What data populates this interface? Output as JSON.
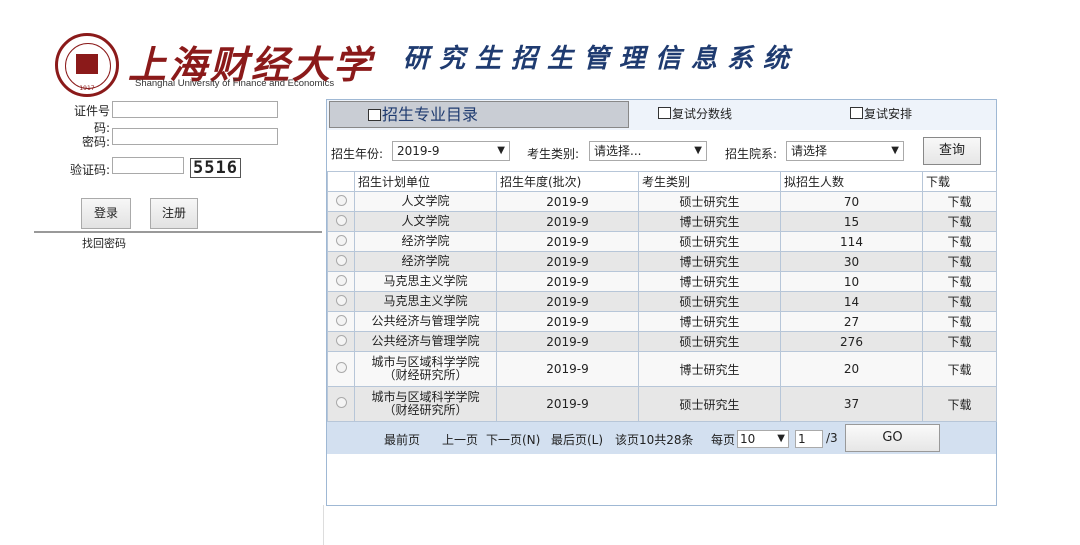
{
  "header": {
    "seal_year": "1917",
    "university_cn": "上海财经大学",
    "university_en": "Shanghai University of Finance and Economics",
    "system_title": "研究生招生管理信息系统"
  },
  "login": {
    "id_label": "证件号码:",
    "password_label": "密码:",
    "captcha_label": "验证码:",
    "captcha_value": "5516",
    "login_button": "登录",
    "register_button": "注册",
    "forgot_link": "找回密码"
  },
  "tabs": {
    "catalog": "招生专业目录",
    "retest_score": "复试分数线",
    "retest_schedule": "复试安排"
  },
  "filters": {
    "year_label": "招生年份:",
    "year_value": "2019-9",
    "type_label": "考生类别:",
    "type_value": "请选择...",
    "school_label": "招生院系:",
    "school_value": "请选择",
    "query_button": "查询"
  },
  "table": {
    "headers": [
      "招生计划单位",
      "招生年度(批次)",
      "考生类别",
      "拟招生人数",
      "下载"
    ],
    "rows": [
      {
        "unit": "人文学院",
        "unit2": "",
        "year": "2019-9",
        "type": "硕士研究生",
        "count": "70",
        "dl": "下载"
      },
      {
        "unit": "人文学院",
        "unit2": "",
        "year": "2019-9",
        "type": "博士研究生",
        "count": "15",
        "dl": "下载"
      },
      {
        "unit": "经济学院",
        "unit2": "",
        "year": "2019-9",
        "type": "硕士研究生",
        "count": "114",
        "dl": "下载"
      },
      {
        "unit": "经济学院",
        "unit2": "",
        "year": "2019-9",
        "type": "博士研究生",
        "count": "30",
        "dl": "下载"
      },
      {
        "unit": "马克思主义学院",
        "unit2": "",
        "year": "2019-9",
        "type": "博士研究生",
        "count": "10",
        "dl": "下载"
      },
      {
        "unit": "马克思主义学院",
        "unit2": "",
        "year": "2019-9",
        "type": "硕士研究生",
        "count": "14",
        "dl": "下载"
      },
      {
        "unit": "公共经济与管理学院",
        "unit2": "",
        "year": "2019-9",
        "type": "博士研究生",
        "count": "27",
        "dl": "下载"
      },
      {
        "unit": "公共经济与管理学院",
        "unit2": "",
        "year": "2019-9",
        "type": "硕士研究生",
        "count": "276",
        "dl": "下载"
      },
      {
        "unit": "城市与区域科学学院",
        "unit2": "（财经研究所）",
        "year": "2019-9",
        "type": "博士研究生",
        "count": "20",
        "dl": "下载"
      },
      {
        "unit": "城市与区域科学学院",
        "unit2": "（财经研究所）",
        "year": "2019-9",
        "type": "硕士研究生",
        "count": "37",
        "dl": "下载"
      }
    ]
  },
  "pager": {
    "first": "最前页",
    "prev": "上一页",
    "next": "下一页(N)",
    "last": "最后页(L)",
    "summary": "该页10共28条",
    "per_page_label": "每页",
    "per_page_value": "10",
    "page_value": "1",
    "total_pages": "/3",
    "go_button": "GO"
  }
}
